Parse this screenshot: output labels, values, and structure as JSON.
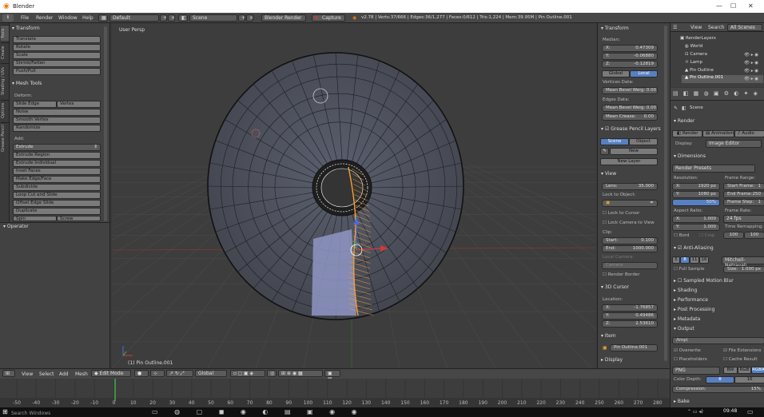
{
  "window": {
    "app_title": "Blender",
    "minimize": "—",
    "maximize": "☐",
    "close": "✕"
  },
  "infobar": {
    "menus": [
      "File",
      "Render",
      "Window",
      "Help"
    ],
    "screen_layout": "Default",
    "scene": "Scene",
    "engine": "Blender Render",
    "capture_label": "Capture",
    "stats": "v2.78 | Verts:37/666 | Edges:36/1,277 | Faces:0/612 | Tris:1,224 | Mem:39.95M | Pin Outline.001"
  },
  "toolshelf": {
    "tabs": [
      "Tools",
      "Create",
      "Shading / UVs",
      "Options",
      "Grease Pencil"
    ],
    "transform_header": "Transform",
    "transform_buttons": [
      "Translate",
      "Rotate",
      "Scale",
      "Shrink/Fatten",
      "Push/Pull"
    ],
    "mesh_tools_header": "Mesh Tools",
    "deform_label": "Deform:",
    "slide_edge": "Slide Edge",
    "vertex": "Vertex",
    "deform_buttons": [
      "Noise",
      "Smooth Vertex",
      "Randomize"
    ],
    "add_label": "Add:",
    "extrude": "Extrude",
    "add_buttons": [
      "Extrude Region",
      "Extrude Individual",
      "Inset Faces",
      "Make Edge/Face",
      "Subdivide",
      "Loop Cut and Slide",
      "Offset Edge Slide",
      "Duplicate"
    ],
    "spin": "Spin",
    "screw": "Screw",
    "operator_header": "Operator"
  },
  "viewport": {
    "view_label": "User Persp",
    "object_label": "(1) Pin Outline.001"
  },
  "npanel": {
    "transform_header": "Transform",
    "median_label": "Median:",
    "median": [
      {
        "axis": "X:",
        "value": "0.47309"
      },
      {
        "axis": "Y:",
        "value": "-0.06880"
      },
      {
        "axis": "Z:",
        "value": "-0.12819"
      }
    ],
    "global": "Global",
    "local": "Local",
    "vertices_data_label": "Vertices Data:",
    "mean_bevel_weight_v": "Mean Bevel Weig: 0.00",
    "edges_data_label": "Edges Data:",
    "mean_bevel_weight_e": "Mean Bevel Weig: 0.00",
    "mean_crease": "Mean Crease:",
    "mean_crease_value": "0.00",
    "grease_header": "Grease Pencil Layers",
    "scene_btn": "Scene",
    "object_btn": "Object",
    "new_btn": "New",
    "new_layer_btn": "New Layer",
    "view_header": "View",
    "lens_label": "Lens:",
    "lens_value": "35.000",
    "lock_to_object": "Lock to Object:",
    "lock_to_cursor": "Lock to Cursor",
    "lock_camera": "Lock Camera to View",
    "clip_label": "Clip:",
    "clip_start_label": "Start:",
    "clip_start": "0.100",
    "clip_end_label": "End:",
    "clip_end": "1000.000",
    "local_camera_label": "Local Camera:",
    "local_camera_value": "Camera",
    "render_border": "Render Border",
    "cursor_header": "3D Cursor",
    "location_label": "Location:",
    "cursor": [
      {
        "axis": "X:",
        "value": "-1.76857"
      },
      {
        "axis": "Y:",
        "value": "0.49486"
      },
      {
        "axis": "Z:",
        "value": "2.53610"
      }
    ],
    "item_header": "Item",
    "item_name": "Pin Outline.001",
    "display_header": "Display"
  },
  "outliner": {
    "view": "View",
    "search": "Search",
    "all_scenes": "All Scenes",
    "items": [
      "RenderLayers",
      "World",
      "Camera",
      "Lamp",
      "Pin Outline",
      "Pin Outline.001"
    ]
  },
  "properties": {
    "scene_path": "Scene",
    "render_header": "Render",
    "render_btn": "Render",
    "animation_btn": "Animation",
    "audio_btn": "Audio",
    "display_label": "Display:",
    "display_value": "Image Editor",
    "dimensions_header": "Dimensions",
    "render_presets": "Render Presets",
    "resolution_label": "Resolution:",
    "res_x": "1920 px",
    "res_y": "1080 px",
    "res_pct": "50%",
    "frame_range_label": "Frame Range:",
    "start_frame": "Start Frame:",
    "start_frame_v": "1",
    "end_frame": "End Frame:",
    "end_frame_v": "250",
    "frame_step": "Frame Step:",
    "frame_step_v": "1",
    "aspect_label": "Aspect Ratio:",
    "aspect_x": "1.000",
    "aspect_y": "1.000",
    "frame_rate_label": "Frame Rate:",
    "frame_rate": "24 fps",
    "time_remap_label": "Time Remapping:",
    "remap_old": "100",
    "remap_new": "100",
    "bord": "Bord",
    "crop": "Crop",
    "aa_header": "Anti-Aliasing",
    "aa_samples": [
      "5",
      "8",
      "11",
      "16"
    ],
    "aa_filter": "Mitchell-Netravali",
    "full_sample": "Full Sample",
    "aa_size": "Size:",
    "aa_size_v": "1.000 px",
    "panels": [
      "Sampled Motion Blur",
      "Shading",
      "Performance",
      "Post Processing",
      "Metadata"
    ],
    "output_header": "Output",
    "output_path": "/tmp\\",
    "overwrite": "Overwrite",
    "file_ext": "File Extensions",
    "placeholders": "Placeholders",
    "cache_result": "Cache Result",
    "format": "PNG",
    "bw": "BW",
    "rgb": "RGB",
    "rgba": "RGBA",
    "color_depth": "Color Depth:",
    "depth8": "8",
    "depth16": "16",
    "compression": "Compression:",
    "compression_v": "15%",
    "bake_header": "Bake"
  },
  "viewport_header": {
    "menus": [
      "View",
      "Select",
      "Add",
      "Mesh"
    ],
    "mode": "Edit Mode",
    "orientation": "Global"
  },
  "timeline": {
    "ticks": [
      "-50",
      "-40",
      "-30",
      "-20",
      "-10",
      "0",
      "10",
      "20",
      "30",
      "40",
      "50",
      "60",
      "70",
      "80",
      "90",
      "100",
      "110",
      "120",
      "130",
      "140",
      "150",
      "160",
      "170",
      "180",
      "190",
      "200",
      "210",
      "220",
      "230",
      "240",
      "250",
      "260",
      "270",
      "280"
    ]
  },
  "taskbar": {
    "search": "Search Windows",
    "time": "09:48"
  },
  "colors": {
    "accent": "#5680c2",
    "selected_orange": "#f5a033",
    "panel": "#424242",
    "viewport": "#3d3d3d"
  }
}
